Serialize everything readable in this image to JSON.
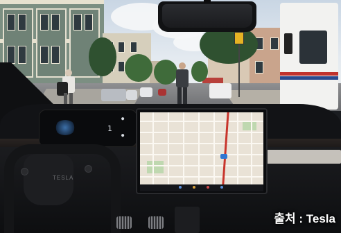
{
  "photo": {
    "caption": "출처 : Tesla"
  }
}
